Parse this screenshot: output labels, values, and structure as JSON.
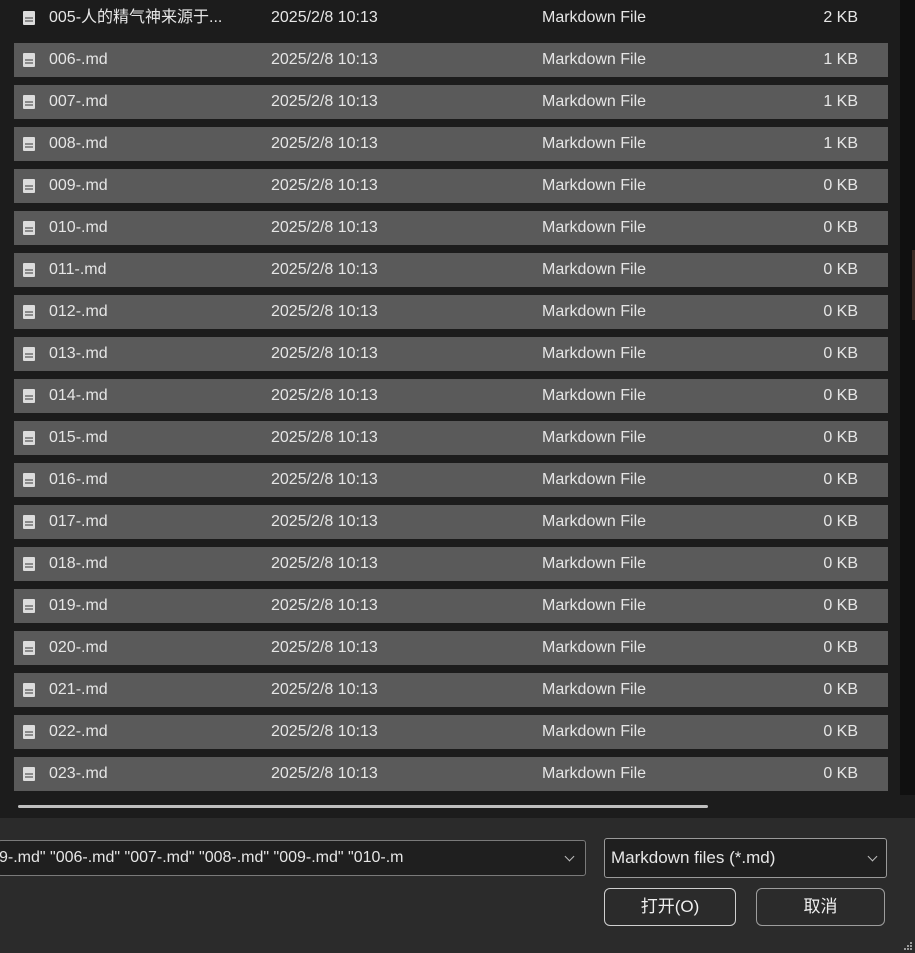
{
  "files": [
    {
      "name": "005-人的精气神来源于...",
      "date": "2025/2/8 10:13",
      "type": "Markdown File",
      "size": "2 KB"
    },
    {
      "name": "006-.md",
      "date": "2025/2/8 10:13",
      "type": "Markdown File",
      "size": "1 KB"
    },
    {
      "name": "007-.md",
      "date": "2025/2/8 10:13",
      "type": "Markdown File",
      "size": "1 KB"
    },
    {
      "name": "008-.md",
      "date": "2025/2/8 10:13",
      "type": "Markdown File",
      "size": "1 KB"
    },
    {
      "name": "009-.md",
      "date": "2025/2/8 10:13",
      "type": "Markdown File",
      "size": "0 KB"
    },
    {
      "name": "010-.md",
      "date": "2025/2/8 10:13",
      "type": "Markdown File",
      "size": "0 KB"
    },
    {
      "name": "011-.md",
      "date": "2025/2/8 10:13",
      "type": "Markdown File",
      "size": "0 KB"
    },
    {
      "name": "012-.md",
      "date": "2025/2/8 10:13",
      "type": "Markdown File",
      "size": "0 KB"
    },
    {
      "name": "013-.md",
      "date": "2025/2/8 10:13",
      "type": "Markdown File",
      "size": "0 KB"
    },
    {
      "name": "014-.md",
      "date": "2025/2/8 10:13",
      "type": "Markdown File",
      "size": "0 KB"
    },
    {
      "name": "015-.md",
      "date": "2025/2/8 10:13",
      "type": "Markdown File",
      "size": "0 KB"
    },
    {
      "name": "016-.md",
      "date": "2025/2/8 10:13",
      "type": "Markdown File",
      "size": "0 KB"
    },
    {
      "name": "017-.md",
      "date": "2025/2/8 10:13",
      "type": "Markdown File",
      "size": "0 KB"
    },
    {
      "name": "018-.md",
      "date": "2025/2/8 10:13",
      "type": "Markdown File",
      "size": "0 KB"
    },
    {
      "name": "019-.md",
      "date": "2025/2/8 10:13",
      "type": "Markdown File",
      "size": "0 KB"
    },
    {
      "name": "020-.md",
      "date": "2025/2/8 10:13",
      "type": "Markdown File",
      "size": "0 KB"
    },
    {
      "name": "021-.md",
      "date": "2025/2/8 10:13",
      "type": "Markdown File",
      "size": "0 KB"
    },
    {
      "name": "022-.md",
      "date": "2025/2/8 10:13",
      "type": "Markdown File",
      "size": "0 KB"
    },
    {
      "name": "023-.md",
      "date": "2025/2/8 10:13",
      "type": "Markdown File",
      "size": "0 KB"
    }
  ],
  "footer": {
    "filename_value": "9-.md\" \"006-.md\" \"007-.md\" \"008-.md\" \"009-.md\" \"010-.m",
    "filetype_value": "Markdown files (*.md)",
    "open_label": "打开(O)",
    "cancel_label": "取消"
  },
  "colors": {
    "background": "#1c1c1c",
    "selected_row": "#5a5a5a",
    "footer": "#2b2b2b"
  },
  "icons": {
    "file": "markdown-file-icon",
    "dropdown": "chevron-down-icon"
  }
}
